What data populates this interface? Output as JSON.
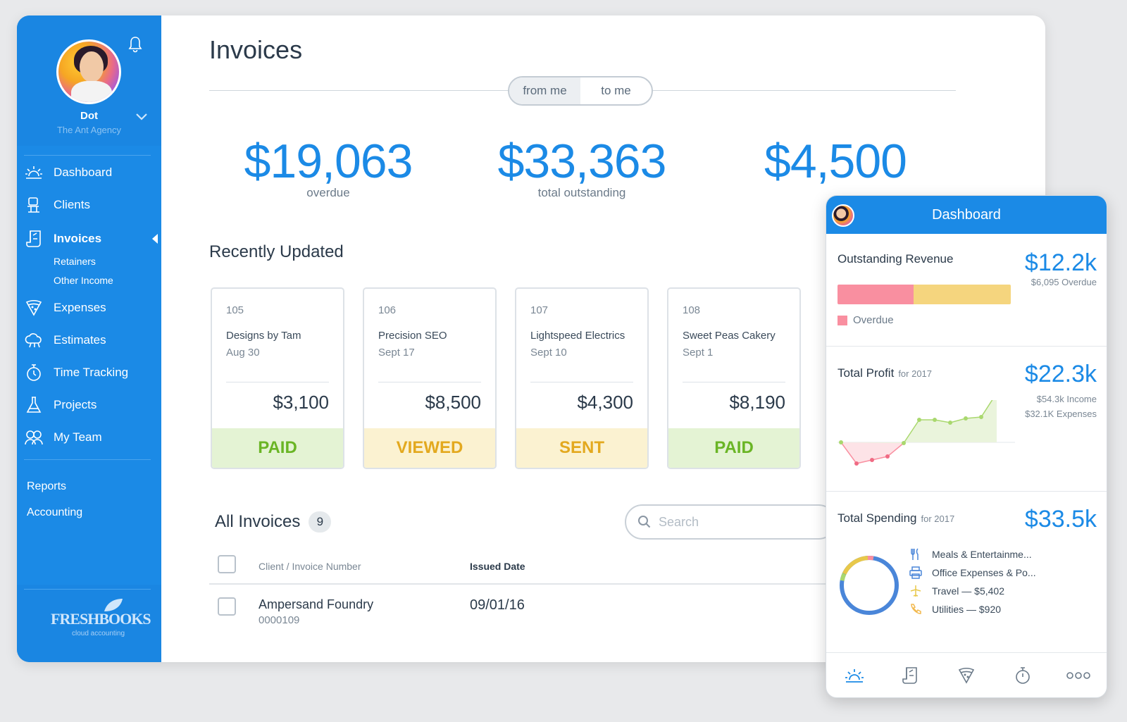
{
  "sidebar": {
    "user_name": "Dot",
    "company": "The Ant Agency",
    "nav": [
      {
        "label": "Dashboard",
        "icon": "sun-icon"
      },
      {
        "label": "Clients",
        "icon": "desk-icon"
      },
      {
        "label": "Invoices",
        "icon": "invoice-icon",
        "active": true
      },
      {
        "label": "Expenses",
        "icon": "pizza-icon"
      },
      {
        "label": "Estimates",
        "icon": "cloud-icon"
      },
      {
        "label": "Time Tracking",
        "icon": "stopwatch-icon"
      },
      {
        "label": "Projects",
        "icon": "flask-icon"
      },
      {
        "label": "My Team",
        "icon": "team-icon"
      }
    ],
    "invoice_subitems": [
      "Retainers",
      "Other Income"
    ],
    "links": [
      "Reports",
      "Accounting"
    ],
    "logo_text": "FRESHBOOKS",
    "logo_sub": "cloud accounting"
  },
  "main": {
    "title": "Invoices",
    "toggle": {
      "from_me": "from me",
      "to_me": "to me",
      "selected": "from me"
    },
    "stats": [
      {
        "amount": "$19,063",
        "label": "overdue"
      },
      {
        "amount": "$33,363",
        "label": "total outstanding"
      },
      {
        "amount": "$4,500",
        "label": ""
      }
    ],
    "recently_updated_title": "Recently Updated",
    "cards": [
      {
        "number": "105",
        "client": "Designs by Tam",
        "date": "Aug 30",
        "amount": "$3,100",
        "status": "PAID"
      },
      {
        "number": "106",
        "client": "Precision SEO",
        "date": "Sept 17",
        "amount": "$8,500",
        "status": "VIEWED"
      },
      {
        "number": "107",
        "client": "Lightspeed Electrics",
        "date": "Sept 10",
        "amount": "$4,300",
        "status": "SENT"
      },
      {
        "number": "108",
        "client": "Sweet Peas Cakery",
        "date": "Sept 1",
        "amount": "$8,190",
        "status": "PAID"
      }
    ],
    "all_invoices": {
      "title": "All Invoices",
      "count": "9",
      "search_placeholder": "Search",
      "columns": [
        "Client / Invoice Number",
        "Issued Date"
      ],
      "rows": [
        {
          "client": "Ampersand Foundry",
          "number": "0000109",
          "issued": "09/01/16"
        }
      ]
    }
  },
  "mobile": {
    "title": "Dashboard",
    "outstanding": {
      "label": "Outstanding Revenue",
      "value": "$12.2k",
      "sub": "$6,095 Overdue",
      "legend": "Overdue",
      "overdue_fraction": 0.44
    },
    "profit": {
      "label": "Total Profit",
      "period": "for 2017",
      "value": "$22.3k",
      "income": "$54.3k Income",
      "expenses": "$32.1K Expenses"
    },
    "spending": {
      "label": "Total Spending",
      "period": "for 2017",
      "value": "$33.5k",
      "items": [
        {
          "label": "Meals & Entertainme...",
          "icon": "fork-knife-icon"
        },
        {
          "label": "Office Expenses & Po...",
          "icon": "printer-icon"
        },
        {
          "label": "Travel — $5,402",
          "icon": "plane-icon"
        },
        {
          "label": "Utilities — $920",
          "icon": "phone-icon"
        }
      ]
    },
    "tabs": [
      "sun-icon",
      "invoice-icon",
      "pizza-icon",
      "stopwatch-icon",
      "more-icon"
    ]
  },
  "colors": {
    "brand_blue": "#1b8ae6",
    "paid_green": "#6ab525",
    "viewed_yellow": "#e3a91f",
    "overdue_pink": "#f98fa0"
  }
}
